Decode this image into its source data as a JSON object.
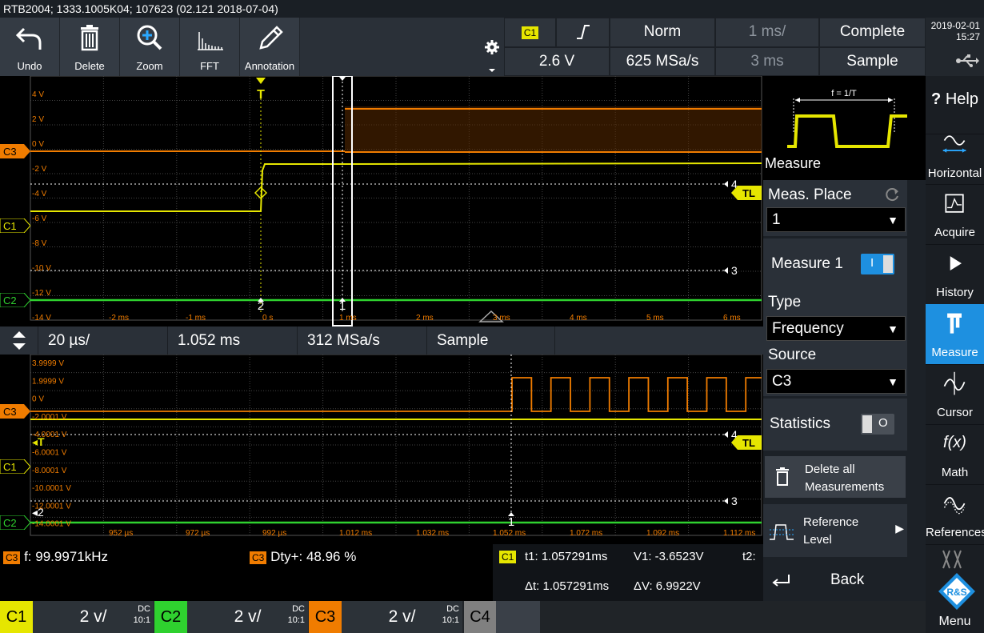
{
  "title": "RTB2004; 1333.1005K04; 107623 (02.121 2018-07-04)",
  "toolbar": {
    "undo": "Undo",
    "delete": "Delete",
    "zoom": "Zoom",
    "fft": "FFT",
    "annotation": "Annotation"
  },
  "trigger": {
    "source": "C1",
    "mode": "Norm",
    "level": "2.6 V",
    "sample_rate": "625 MSa/s",
    "timebase": "1 ms/",
    "position": "3 ms",
    "acq_state": "Complete",
    "acq_mode": "Sample"
  },
  "clock": {
    "date": "2019-02-01",
    "time": "15:27"
  },
  "scope": {
    "y_labels": [
      "4 V",
      "2 V",
      "0 V",
      "-2 V",
      "-4 V",
      "-6 V",
      "-8 V",
      "-10 V",
      "-12 V",
      "-14 V"
    ],
    "x_labels": [
      "-2 ms",
      "-1 ms",
      "0 s",
      "1 ms",
      "2 ms",
      "3 ms",
      "4 ms",
      "5 ms",
      "6 ms"
    ],
    "trigger_marker": "T",
    "tl_marker": "TL",
    "cursor1": "1",
    "cursor2": "2",
    "ref3": "3",
    "ref4": "4"
  },
  "channels": {
    "c1": {
      "label": "C1",
      "color": "#e6e600"
    },
    "c2": {
      "label": "C2",
      "color": "#2fd12f"
    },
    "c3": {
      "label": "C3",
      "color": "#f07c00"
    },
    "c4": {
      "label": "C4",
      "color": "#808080"
    }
  },
  "zoombar": {
    "timebase": "20 µs/",
    "position": "1.052 ms",
    "sample_rate": "312 MSa/s",
    "mode": "Sample"
  },
  "zoom": {
    "y_labels": [
      "3.9999 V",
      "1.9999 V",
      "0 V",
      "-2.0001 V",
      "-4.0001 V",
      "-6.0001 V",
      "-8.0001 V",
      "-10.0001 V",
      "-12.0001 V",
      "-14.0001 V"
    ],
    "x_labels": [
      "952 µs",
      "972 µs",
      "992 µs",
      "1.012 ms",
      "1.032 ms",
      "1.052 ms",
      "1.072 ms",
      "1.092 ms",
      "1.112 ms"
    ]
  },
  "measure_panel": {
    "diagram_label": "f = 1/T",
    "title": "Measure",
    "meas_place_label": "Meas. Place",
    "meas_place_value": "1",
    "measure1_label": "Measure 1",
    "toggle_on": "I",
    "type_label": "Type",
    "type_value": "Frequency",
    "source_label": "Source",
    "source_value": "C3",
    "statistics_label": "Statistics",
    "toggle_off": "O",
    "delete_all_line1": "Delete all",
    "delete_all_line2": "Measurements",
    "reference_line1": "Reference",
    "reference_line2": "Level",
    "back": "Back"
  },
  "right_menu": {
    "help": "Help",
    "horizontal": "Horizontal",
    "acquire": "Acquire",
    "history": "History",
    "measure": "Measure",
    "cursor": "Cursor",
    "math": "Math",
    "math_icon": "f(x)",
    "references": "References",
    "menu": "Menu",
    "rs_logo": "R&S"
  },
  "results": {
    "m1_src": "C3",
    "m1_text": "f: 99.9971kHz",
    "m2_src": "C3",
    "m2_text": "Dty+: 48.96 %",
    "cur_src": "C1",
    "t1": "t1: 1.057291ms",
    "v1": "V1: -3.6523V",
    "t2": "t2:",
    "dt": "Δt: 1.057291ms",
    "dv": "ΔV: 6.9922V"
  },
  "bottom": {
    "c1_scale": "2 v/",
    "c2_scale": "2 v/",
    "c3_scale": "2 v/",
    "coupling": "DC",
    "probe": "10:1"
  }
}
